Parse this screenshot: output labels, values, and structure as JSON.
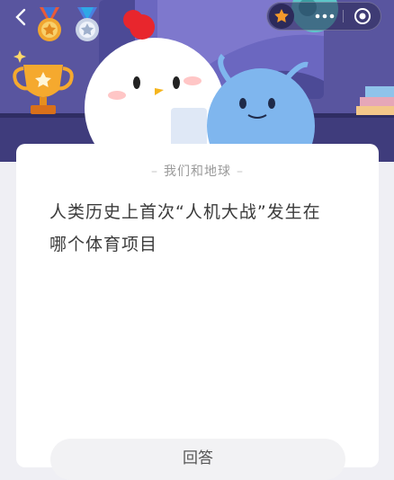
{
  "header": {
    "back_icon": "chevron-left-icon",
    "medals": [
      "gold-medal-icon",
      "silver-medal-icon"
    ],
    "capsule": {
      "star_icon": "star-icon",
      "more_icon": "more-dots-icon",
      "close_icon": "target-circle-icon"
    }
  },
  "quiz": {
    "category": "我们和地球",
    "question_line1": "人类历史上首次“人机大战”发生在",
    "question_line2": "哪个体育项目",
    "answer_button_label": "回答"
  },
  "colors": {
    "banner": "#5a56a9",
    "accent_star": "#f39a2b",
    "chick_comb": "#e8262d",
    "alien": "#7fb6ee"
  }
}
